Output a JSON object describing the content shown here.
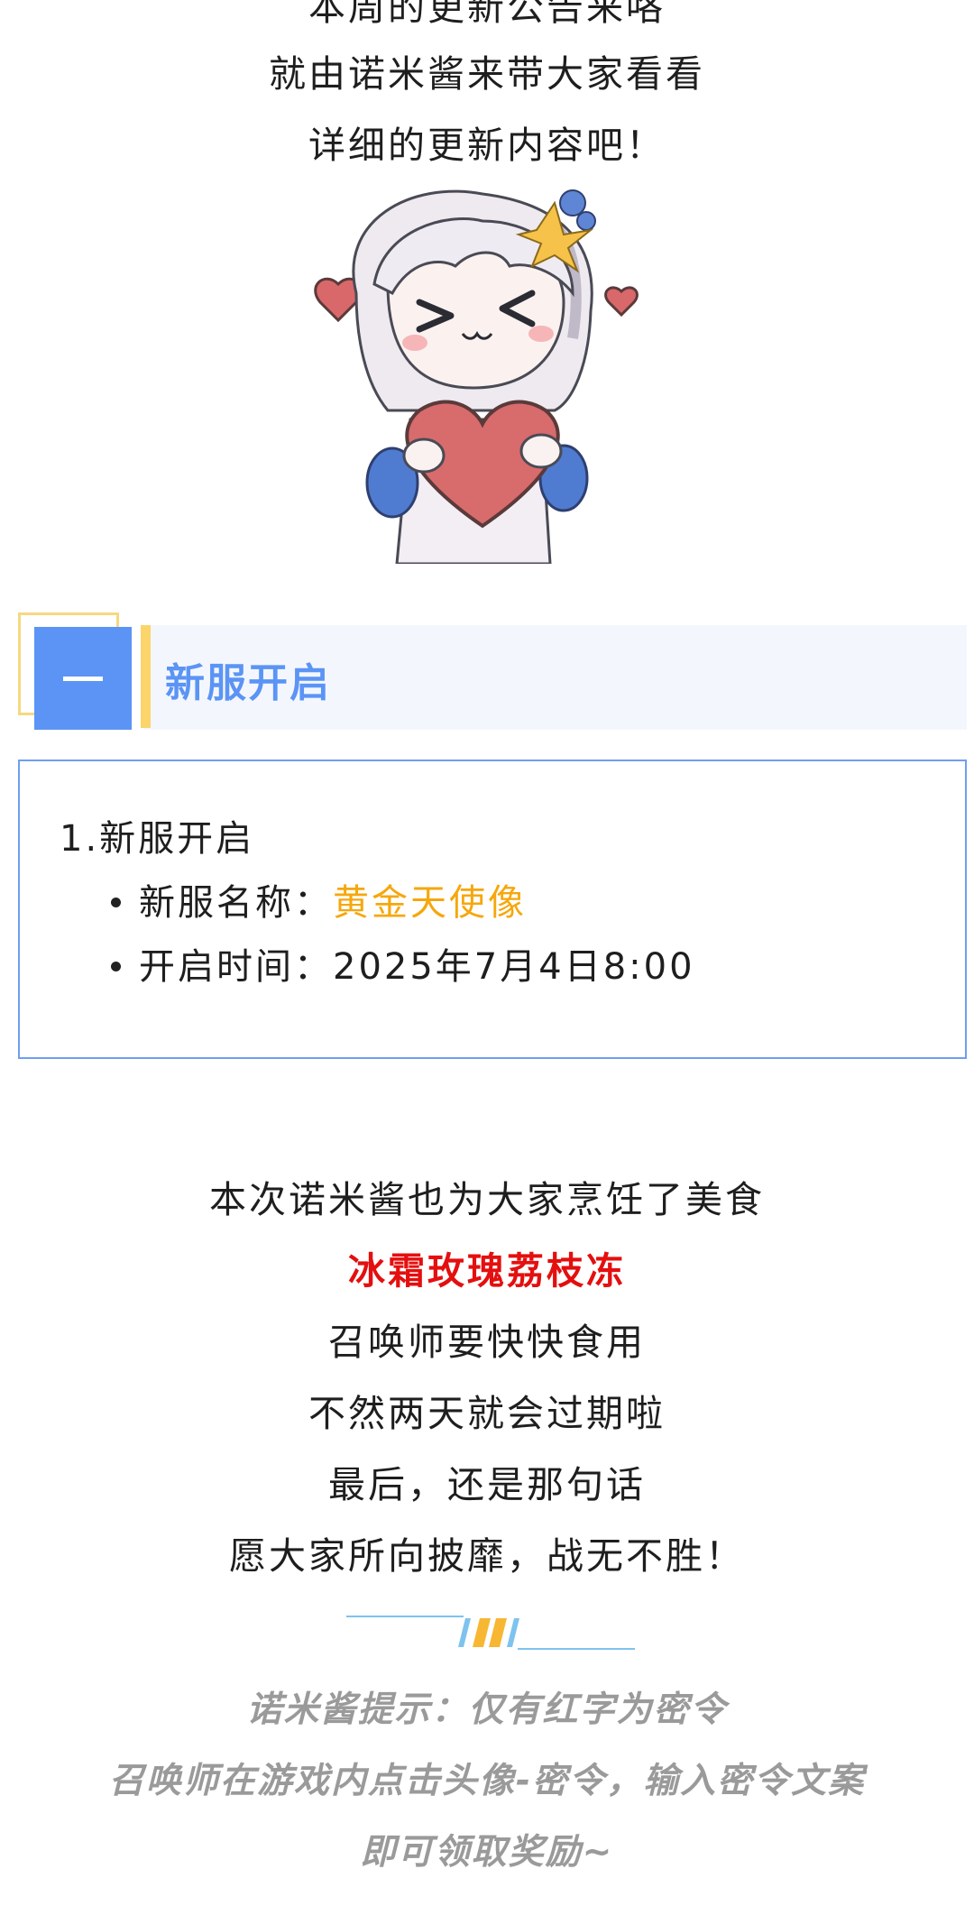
{
  "intro": {
    "line_top_partial": "本周的更新公告来咯",
    "line_1": "就由诺米酱来带大家看看",
    "line_2": "详细的更新内容吧！"
  },
  "section": {
    "number": "一",
    "title": "新服开启"
  },
  "box": {
    "item_heading": "1.新服开启",
    "bullets": [
      {
        "label": "新服名称：",
        "value": "黄金天使像"
      },
      {
        "label": "开启时间：",
        "value": "2025年7月4日8:00"
      }
    ]
  },
  "closing": {
    "line_1": "本次诺米酱也为大家烹饪了美食",
    "red_code": "冰霜玫瑰荔枝冻",
    "line_3": "召唤师要快快食用",
    "line_4": "不然两天就会过期啦",
    "line_5": "最后，还是那句话",
    "line_6": "愿大家所向披靡，战无不胜！"
  },
  "tips": {
    "line_1": "诺米酱提示：仅有红字为密令",
    "line_2": "召唤师在游戏内点击头像-密令，输入密令文案",
    "line_3": "即可领取奖励~"
  },
  "colors": {
    "accent_blue": "#5b94f5",
    "accent_gold": "#f6a70c",
    "code_red": "#e40f0f",
    "stripe_yellow": "#fbd56b"
  },
  "icons": {
    "mascot": "chibi-girl-with-heart-illustration",
    "divider": "slash-stripe-divider"
  }
}
